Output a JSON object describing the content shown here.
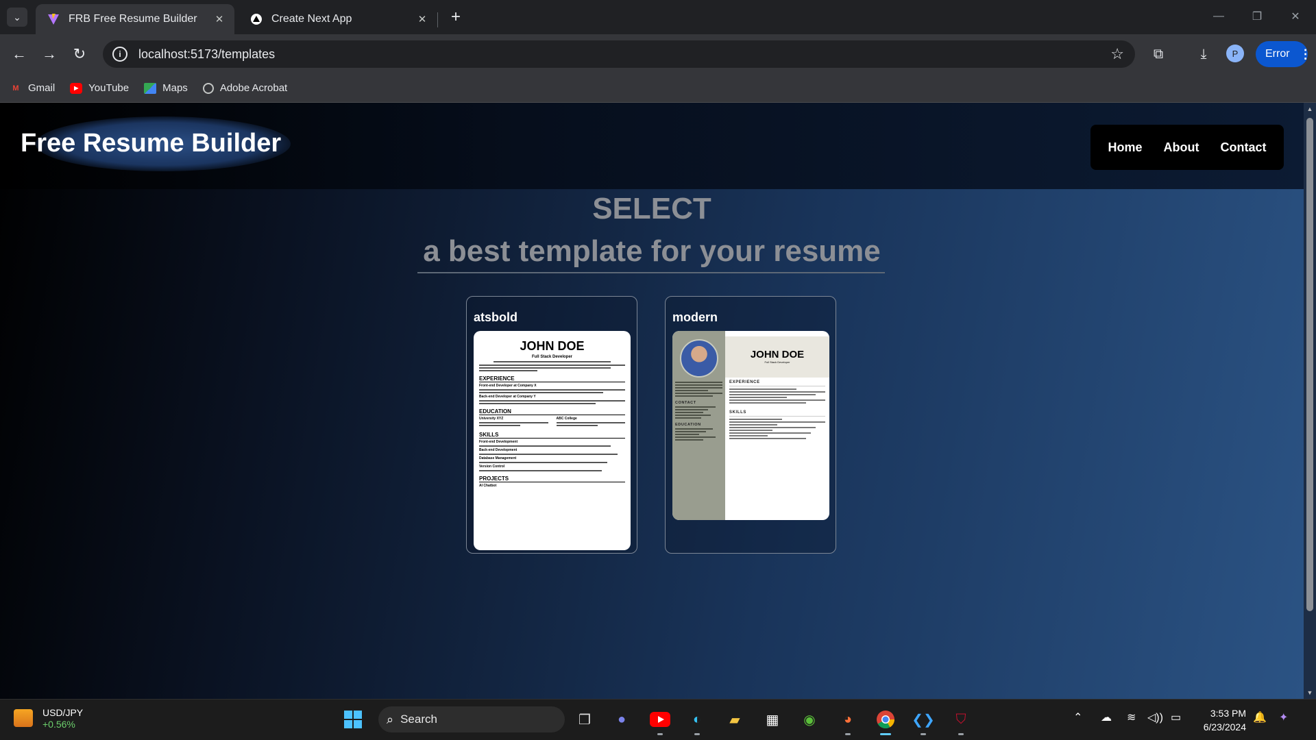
{
  "browser": {
    "tabs": [
      {
        "title": "FRB Free Resume Builder",
        "active": true
      },
      {
        "title": "Create Next App",
        "active": false
      }
    ],
    "url": "localhost:5173/templates",
    "profile_initial": "P",
    "error_label": "Error",
    "bookmarks": [
      "Gmail",
      "YouTube",
      "Maps",
      "Adobe Acrobat"
    ]
  },
  "site": {
    "brand": "Free Resume Builder",
    "nav": [
      "Home",
      "About",
      "Contact"
    ],
    "heading_line1": "SELECT",
    "heading_line2": "a best template for your resume"
  },
  "templates": [
    {
      "name": "atsbold",
      "preview": {
        "name": "JOHN DOE",
        "role": "Full Stack Developer",
        "sections": [
          "EXPERIENCE",
          "EDUCATION",
          "SKILLS",
          "PROJECTS"
        ],
        "experience": [
          "Front-end Developer at Company X",
          "Back-end Developer at Company Y"
        ],
        "education": [
          "University XYZ",
          "ABC College"
        ],
        "skills": [
          "Front-end Development",
          "Back-end Development",
          "Database Management",
          "Version Control"
        ],
        "projects": [
          "AI Chatbot"
        ]
      }
    },
    {
      "name": "modern",
      "preview": {
        "name": "JOHN DOE",
        "role": "Full Stack Developer",
        "side_sections": [
          "CONTACT",
          "EDUCATION"
        ],
        "main_sections": [
          "EXPERIENCE",
          "SKILLS"
        ]
      }
    }
  ],
  "taskbar": {
    "ticker_symbol": "USD/JPY",
    "ticker_change": "+0.56%",
    "search_label": "Search",
    "time": "3:53 PM",
    "date": "6/23/2024"
  },
  "colors": {
    "accent": "#0b57d0",
    "page_bg_dark": "#000000",
    "page_bg_light": "#2b5384",
    "heading_gray": "#8c8f95"
  }
}
